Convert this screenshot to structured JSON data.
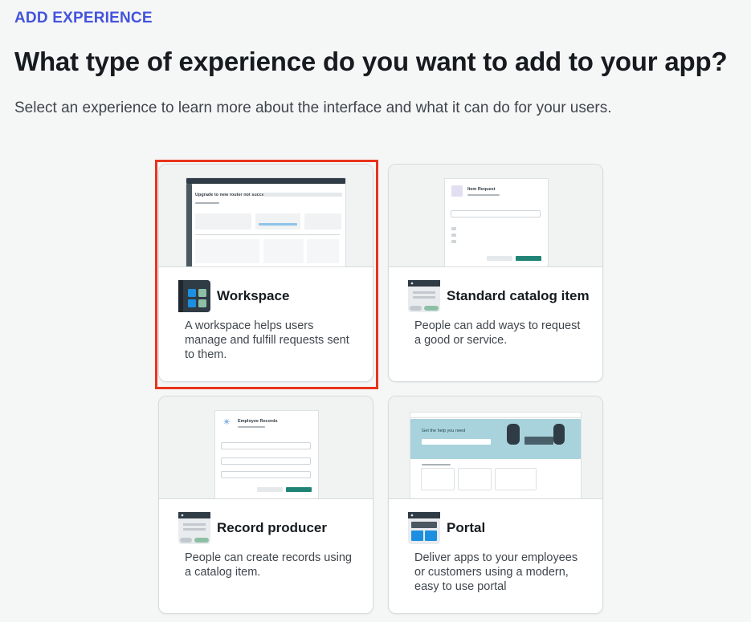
{
  "header": {
    "eyebrow": "ADD EXPERIENCE",
    "title": "What type of experience do you want to add to your app?",
    "subtitle": "Select an experience to learn more about the interface and what it can do for your users."
  },
  "cards": [
    {
      "name": "Workspace",
      "description": "A workspace helps users manage and fulfill requests sent to them.",
      "icon": "workspace-icon",
      "selected": true,
      "preview_title": "Upgrade to new router not successful"
    },
    {
      "name": "Standard catalog item",
      "description": "People can add ways to request a good or service.",
      "icon": "catalog-item-icon",
      "selected": false,
      "preview_title": "Item Request"
    },
    {
      "name": "Record producer",
      "description": "People can create records using a catalog item.",
      "icon": "record-producer-icon",
      "selected": false,
      "preview_title": "Employee Records"
    },
    {
      "name": "Portal",
      "description": "Deliver apps to your employees or customers using a modern, easy to use portal",
      "icon": "portal-icon",
      "selected": false,
      "preview_title": "Get the help you need"
    }
  ],
  "colors": {
    "accent": "#4353dd",
    "selection": "#e8341c",
    "icon_dark": "#2f3b45",
    "icon_blue": "#1d8fe0",
    "icon_green": "#8dbfa6",
    "button_green": "#1f8476"
  }
}
